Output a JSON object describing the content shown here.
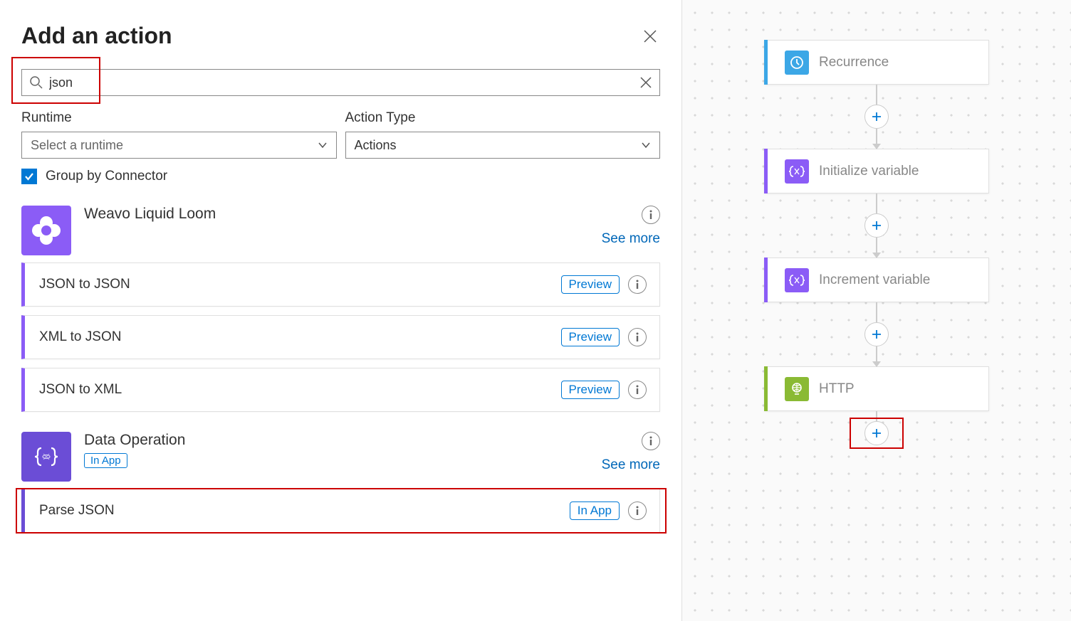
{
  "panel": {
    "title": "Add an action",
    "search_value": "json",
    "runtime_label": "Runtime",
    "runtime_placeholder": "Select a runtime",
    "actiontype_label": "Action Type",
    "actiontype_value": "Actions",
    "group_label": "Group by Connector"
  },
  "connectors": [
    {
      "name": "Weavo Liquid Loom",
      "see_more": "See more",
      "actions": [
        {
          "name": "JSON to JSON",
          "tag": "Preview"
        },
        {
          "name": "XML to JSON",
          "tag": "Preview"
        },
        {
          "name": "JSON to XML",
          "tag": "Preview"
        }
      ]
    },
    {
      "name": "Data Operation",
      "inapp": "In App",
      "see_more": "See more",
      "actions": [
        {
          "name": "Parse JSON",
          "tag": "In App"
        }
      ]
    }
  ],
  "flow": {
    "nodes": [
      {
        "label": "Recurrence"
      },
      {
        "label": "Initialize variable"
      },
      {
        "label": "Increment variable"
      },
      {
        "label": "HTTP"
      }
    ]
  }
}
